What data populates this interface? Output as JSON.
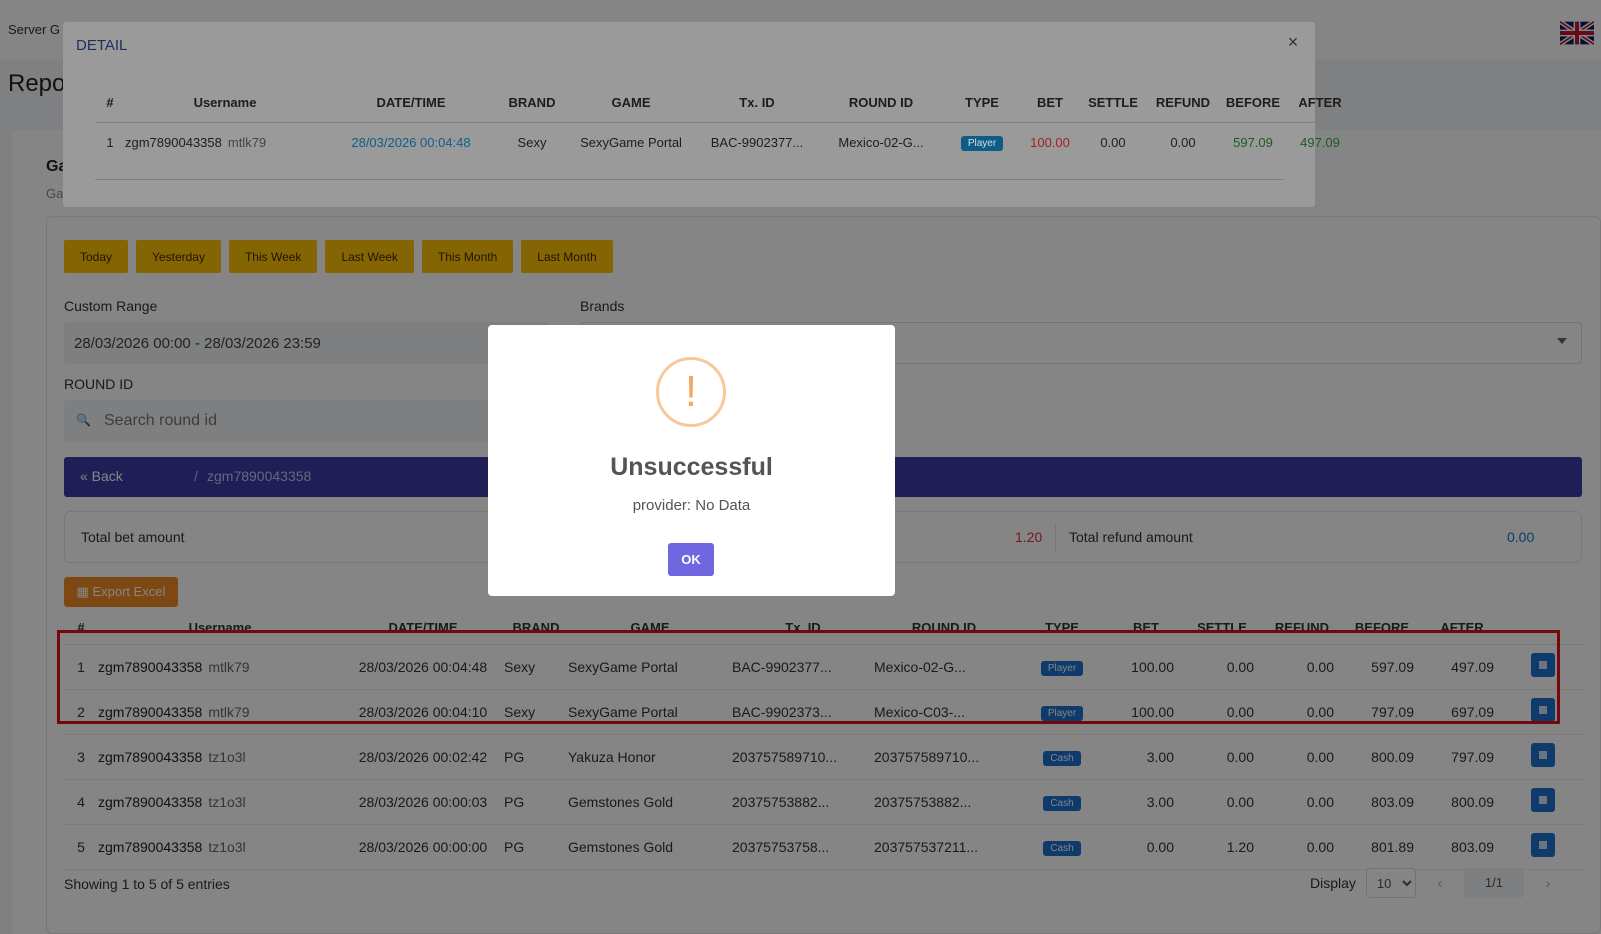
{
  "header": {
    "server_label": "Server G",
    "page_title": "Repo"
  },
  "card": {
    "title": "Ga",
    "subtitle": "Ga"
  },
  "quick_ranges": [
    "Today",
    "Yesterday",
    "This Week",
    "Last Week",
    "This Month",
    "Last Month"
  ],
  "filters": {
    "custom_range_label": "Custom Range",
    "custom_range_value": "28/03/2026 00:00 - 28/03/2026 23:59",
    "brands_label": "Brands",
    "round_id_label": "ROUND ID",
    "round_id_placeholder": "Search round id"
  },
  "breadcrumb": {
    "back": "« Back",
    "separator": "/",
    "current": "zgm7890043358"
  },
  "totals": {
    "bet_label": "Total bet amount",
    "middle_value": "1.20",
    "refund_label": "Total refund amount",
    "refund_value": "0.00"
  },
  "export_label": "Export Excel",
  "table": {
    "headers": [
      "#",
      "Username",
      "DATE/TIME",
      "BRAND",
      "GAME",
      "Tx. ID",
      "ROUND ID",
      "TYPE",
      "BET",
      "SETTLE",
      "REFUND",
      "BEFORE",
      "AFTER"
    ],
    "rows": [
      {
        "n": "1",
        "user": "zgm7890043358",
        "agent": "mtlk79",
        "dt": "28/03/2026 00:04:48",
        "brand": "Sexy",
        "game": "SexyGame Portal",
        "tx": "BAC-9902377...",
        "round": "Mexico-02-G...",
        "type": "Player",
        "bet": "100.00",
        "settle": "0.00",
        "refund": "0.00",
        "before": "597.09",
        "after": "497.09"
      },
      {
        "n": "2",
        "user": "zgm7890043358",
        "agent": "mtlk79",
        "dt": "28/03/2026 00:04:10",
        "brand": "Sexy",
        "game": "SexyGame Portal",
        "tx": "BAC-9902373...",
        "round": "Mexico-C03-...",
        "type": "Player",
        "bet": "100.00",
        "settle": "0.00",
        "refund": "0.00",
        "before": "797.09",
        "after": "697.09"
      },
      {
        "n": "3",
        "user": "zgm7890043358",
        "agent": "tz1o3l",
        "dt": "28/03/2026 00:02:42",
        "brand": "PG",
        "game": "Yakuza Honor",
        "tx": "203757589710...",
        "round": "203757589710...",
        "type": "Cash",
        "bet": "3.00",
        "settle": "0.00",
        "refund": "0.00",
        "before": "800.09",
        "after": "797.09"
      },
      {
        "n": "4",
        "user": "zgm7890043358",
        "agent": "tz1o3l",
        "dt": "28/03/2026 00:00:03",
        "brand": "PG",
        "game": "Gemstones Gold",
        "tx": "20375753882...",
        "round": "20375753882...",
        "type": "Cash",
        "bet": "3.00",
        "settle": "0.00",
        "refund": "0.00",
        "before": "803.09",
        "after": "800.09"
      },
      {
        "n": "5",
        "user": "zgm7890043358",
        "agent": "tz1o3l",
        "dt": "28/03/2026 00:00:00",
        "brand": "PG",
        "game": "Gemstones Gold",
        "tx": "20375753758...",
        "round": "203757537211...",
        "type": "Cash",
        "bet": "0.00",
        "settle": "1.20",
        "refund": "0.00",
        "before": "801.89",
        "after": "803.09"
      }
    ]
  },
  "footer": {
    "showing": "Showing 1 to 5 of 5 entries",
    "display_label": "Display",
    "page_size": "10",
    "prev": "‹",
    "page": "1/1",
    "next": "›"
  },
  "detail_modal": {
    "title": "DETAIL",
    "close": "×",
    "headers": [
      "#",
      "Username",
      "DATE/TIME",
      "BRAND",
      "GAME",
      "Tx. ID",
      "ROUND ID",
      "TYPE",
      "BET",
      "SETTLE",
      "REFUND",
      "BEFORE",
      "AFTER"
    ],
    "row": {
      "n": "1",
      "user": "zgm7890043358",
      "agent": "mtlk79",
      "dt": "28/03/2026 00:04:48",
      "brand": "Sexy",
      "game": "SexyGame Portal",
      "tx": "BAC-9902377...",
      "round": "Mexico-02-G...",
      "type": "Player",
      "bet": "100.00",
      "settle": "0.00",
      "refund": "0.00",
      "before": "597.09",
      "after": "497.09"
    }
  },
  "alert": {
    "icon": "!",
    "title": "Unsuccessful",
    "message": "provider: No Data",
    "ok": "OK"
  }
}
